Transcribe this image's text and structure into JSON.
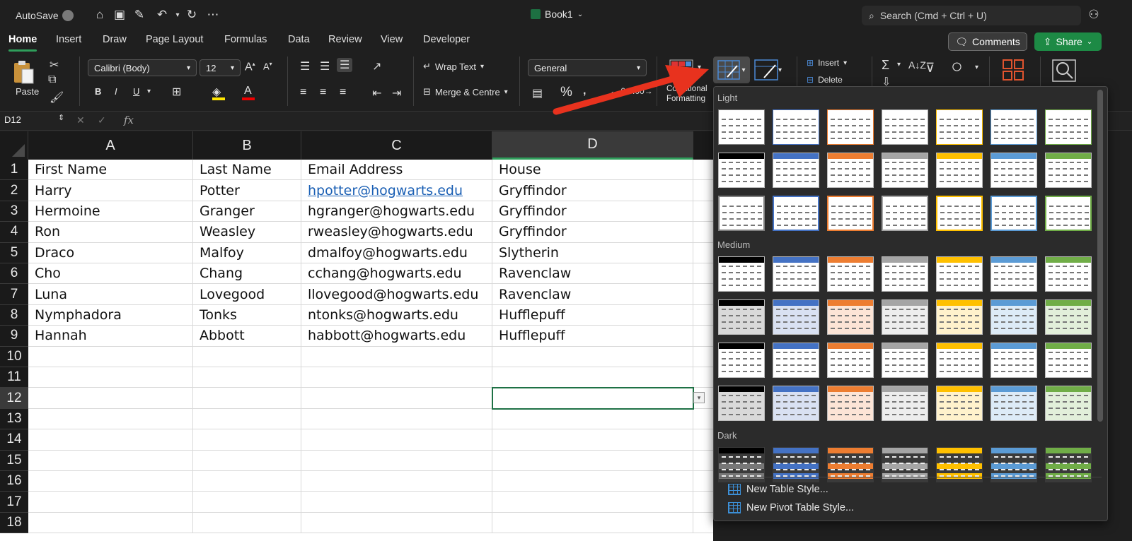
{
  "titlebar": {
    "autosave": "AutoSave",
    "book_title": "Book1",
    "search_placeholder": "Search (Cmd + Ctrl + U)"
  },
  "tabs": [
    "Home",
    "Insert",
    "Draw",
    "Page Layout",
    "Formulas",
    "Data",
    "Review",
    "View",
    "Developer"
  ],
  "buttons": {
    "comments": "Comments",
    "share": "Share"
  },
  "ribbon": {
    "paste": "Paste",
    "font_name": "Calibri (Body)",
    "font_size": "12",
    "bold": "B",
    "italic": "I",
    "underline": "U",
    "wrap_text": "Wrap Text",
    "merge_centre": "Merge & Centre",
    "number_format": "General",
    "percent": "%",
    "conditional_formatting_1": "Conditional",
    "conditional_formatting_2": "Formatting",
    "insert": "Insert",
    "delete": "Delete"
  },
  "formula_bar": {
    "name_box": "D12",
    "fx": "fx"
  },
  "grid": {
    "columns": [
      "A",
      "B",
      "C",
      "D"
    ],
    "rows": [
      "1",
      "2",
      "3",
      "4",
      "5",
      "6",
      "7",
      "8",
      "9",
      "10",
      "11",
      "12",
      "13",
      "14",
      "15",
      "16",
      "17",
      "18"
    ],
    "cells": [
      [
        "First Name",
        "Last Name",
        " Email Address",
        "House"
      ],
      [
        "Harry",
        "Potter",
        "hpotter@hogwarts.edu",
        "Gryffindor"
      ],
      [
        "Hermoine",
        "Granger",
        "hgranger@hogwarts.edu",
        "Gryffindor"
      ],
      [
        "Ron",
        "Weasley",
        "rweasley@hogwarts.edu",
        "Gryffindor"
      ],
      [
        "Draco",
        "Malfoy",
        "dmalfoy@hogwarts.edu",
        "Slytherin"
      ],
      [
        "Cho",
        "Chang",
        "cchang@hogwarts.edu",
        "Ravenclaw"
      ],
      [
        "Luna",
        "Lovegood",
        "llovegood@hogwarts.edu",
        "Ravenclaw"
      ],
      [
        "Nymphadora",
        "Tonks",
        "ntonks@hogwarts.edu",
        "Hufflepuff"
      ],
      [
        "Hannah",
        "Abbott",
        "habbott@hogwarts.edu",
        "Hufflepuff"
      ]
    ],
    "selected_cell": "D12"
  },
  "gallery": {
    "section_light": "Light",
    "section_medium": "Medium",
    "section_dark": "Dark",
    "new_table_style": "New Table Style...",
    "new_pivot_table_style": "New Pivot Table Style...",
    "colors": [
      "#7f7f7f",
      "#4472c4",
      "#ed7d31",
      "#a5a5a5",
      "#ffc000",
      "#5b9bd5",
      "#70ad47"
    ],
    "light_colors": [
      "#d9d9d9",
      "#d9e1f2",
      "#fce4d6",
      "#ededed",
      "#fff2cc",
      "#ddebf7",
      "#e2efda"
    ]
  },
  "colors": {
    "accent_green": "#1d8a45",
    "selection_green": "#1e7145",
    "arrow_red": "#e8321e",
    "link_blue": "#1a5fb4"
  }
}
